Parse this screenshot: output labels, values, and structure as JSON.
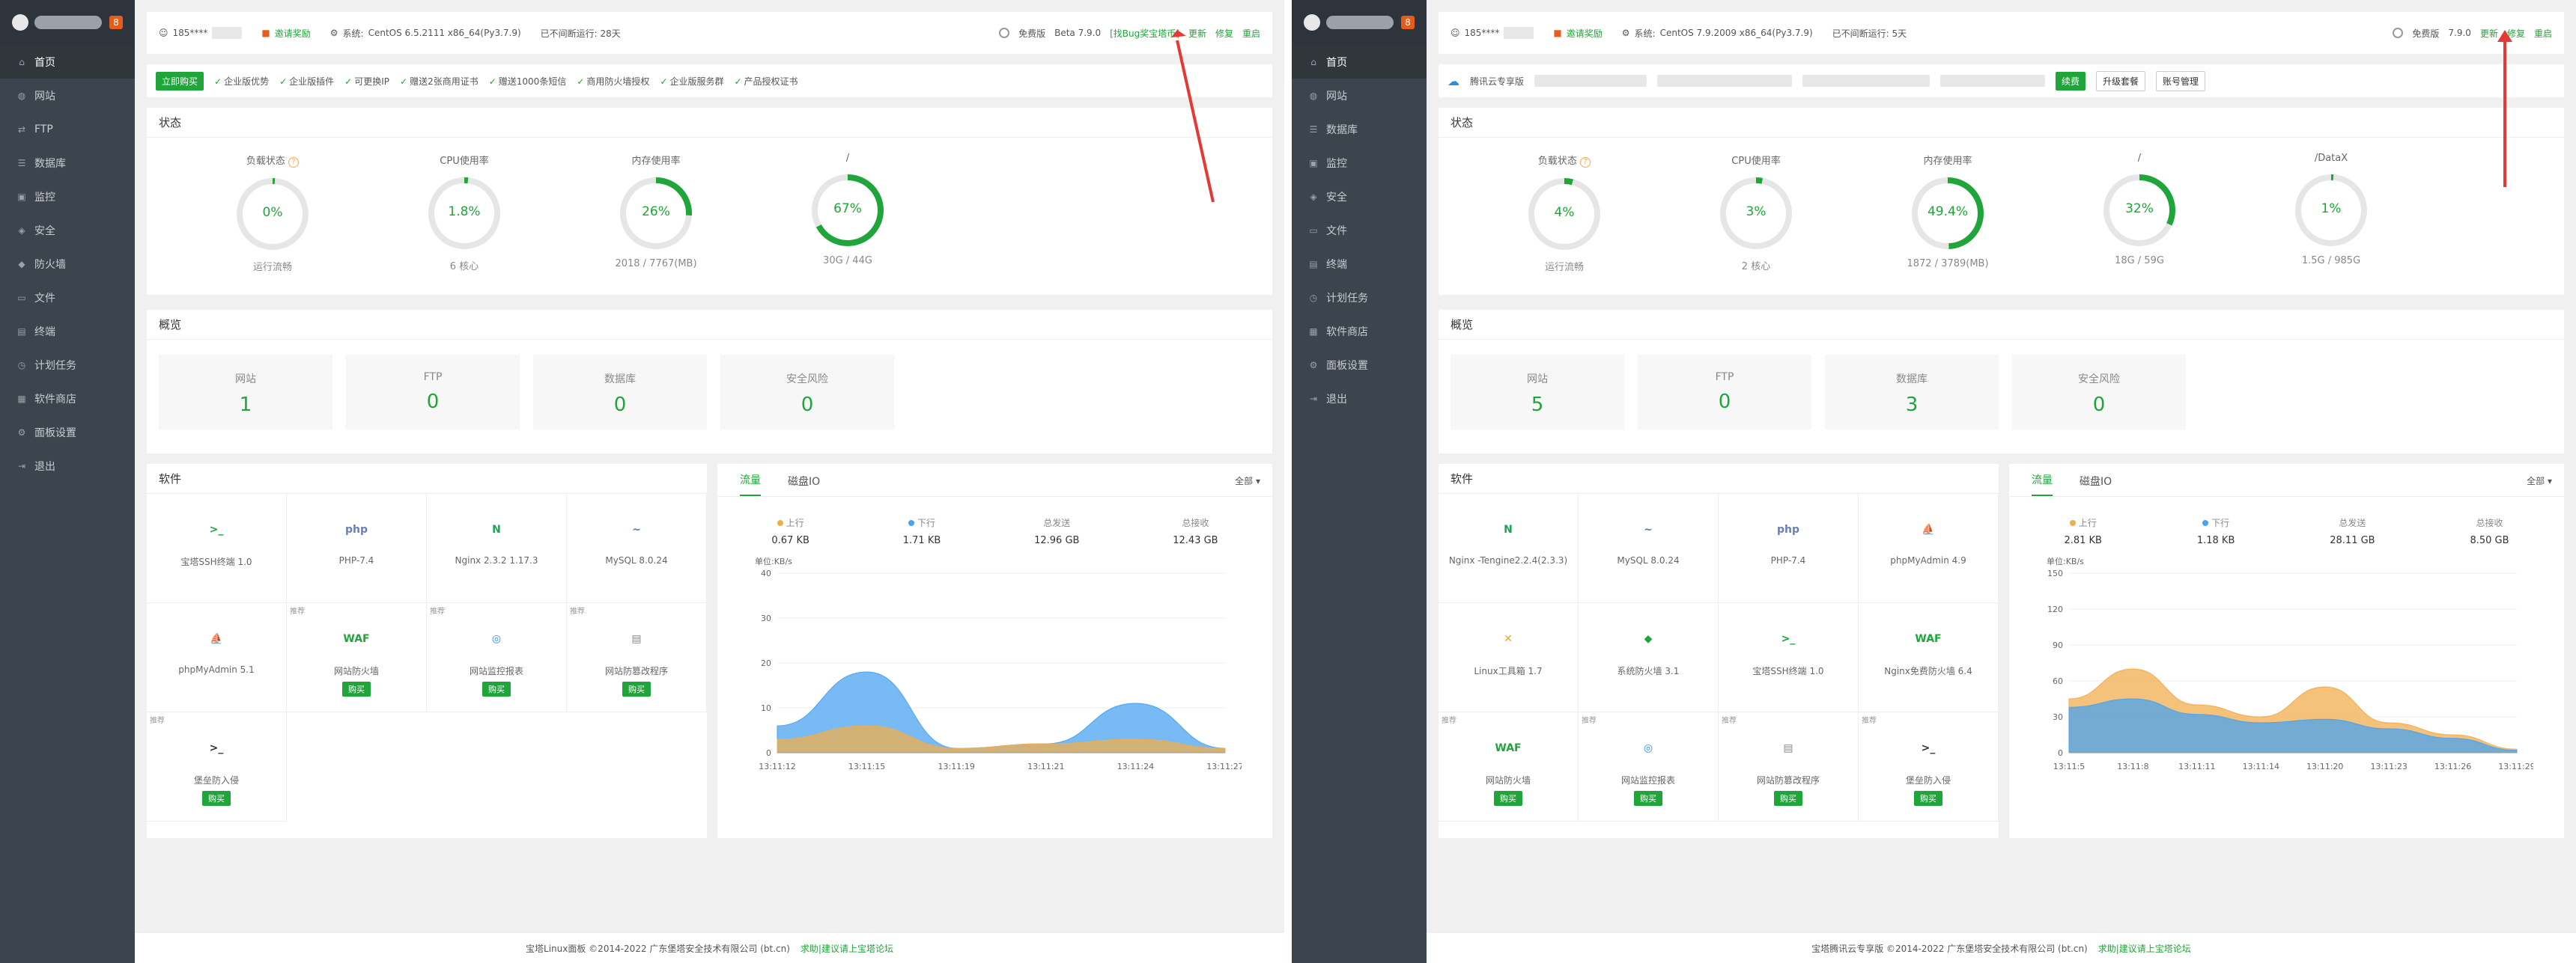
{
  "left": {
    "user_masked": "185****",
    "invite": "邀请奖励",
    "system_label": "系统:",
    "system_value": "CentOS 6.5.2111 x86_64(Py3.7.9)",
    "uptime": "已不间断运行: 28天",
    "edition": "免费版",
    "version": "Beta 7.9.0",
    "bug_link": "[找Bug奖宝塔币]",
    "update": "更新",
    "repair": "修复",
    "restart": "重启",
    "promo_button": "立即购买",
    "promo_items": [
      "企业版优势",
      "企业版插件",
      "可更换IP",
      "赠送2张商用证书",
      "赠送1000条短信",
      "商用防火墙授权",
      "企业版服务群",
      "产品授权证书"
    ],
    "status_title": "状态",
    "gauges": [
      {
        "title": "负载状态",
        "pct": 0,
        "text": "0%",
        "sub": "运行流畅",
        "q": "?"
      },
      {
        "title": "CPU使用率",
        "pct": 1.8,
        "text": "1.8%",
        "sub": "6 核心"
      },
      {
        "title": "内存使用率",
        "pct": 26,
        "text": "26%",
        "sub": "2018 / 7767(MB)"
      },
      {
        "title": "/",
        "pct": 67,
        "text": "67%",
        "sub": "30G / 44G"
      }
    ],
    "overview_title": "概览",
    "overview": [
      {
        "label": "网站",
        "value": "1"
      },
      {
        "label": "FTP",
        "value": "0"
      },
      {
        "label": "数据库",
        "value": "0"
      },
      {
        "label": "安全风险",
        "value": "0"
      }
    ],
    "software_title": "软件",
    "software": [
      {
        "name": "宝塔SSH终端 1.0",
        "icon": "terminal-icon",
        "glyph": ">_",
        "color": "#20a53a",
        "tag": "",
        "buy": ""
      },
      {
        "name": "PHP-7.4",
        "icon": "php-icon",
        "glyph": "php",
        "color": "#6c7eb7",
        "tag": "",
        "buy": ""
      },
      {
        "name": "Nginx 2.3.2 1.17.3",
        "icon": "nginx-icon",
        "glyph": "N",
        "color": "#1aa454",
        "tag": "",
        "buy": ""
      },
      {
        "name": "MySQL 8.0.24",
        "icon": "mysql-icon",
        "glyph": "~",
        "color": "#5a7aa6",
        "tag": "",
        "buy": ""
      },
      {
        "name": "phpMyAdmin 5.1",
        "icon": "phpmyadmin-icon",
        "glyph": "⛵",
        "color": "#e58f1c",
        "tag": "",
        "buy": ""
      },
      {
        "name": "网站防火墙",
        "icon": "waf-icon",
        "glyph": "WAF",
        "color": "#20a53a",
        "tag": "推荐",
        "buy": "购买"
      },
      {
        "name": "网站监控报表",
        "icon": "monitor-icon",
        "glyph": "◎",
        "color": "#2b8fd6",
        "tag": "推荐",
        "buy": "购买"
      },
      {
        "name": "网站防篡改程序",
        "icon": "tamper-icon",
        "glyph": "▤",
        "color": "#888888",
        "tag": "推荐",
        "buy": "购买"
      },
      {
        "name": "堡垒防入侵",
        "icon": "intrusion-icon",
        "glyph": ">_",
        "color": "#333333",
        "tag": "推荐",
        "buy": "购买"
      }
    ],
    "flow_tabs": [
      "流量",
      "磁盘IO"
    ],
    "flow_select": "全部",
    "flow_stats": [
      {
        "label": "上行",
        "value": "0.67 KB",
        "dot": "#f0ad4e"
      },
      {
        "label": "下行",
        "value": "1.71 KB",
        "dot": "#4aa3f0"
      },
      {
        "label": "总发送",
        "value": "12.96 GB",
        "dot": ""
      },
      {
        "label": "总接收",
        "value": "12.43 GB",
        "dot": ""
      }
    ],
    "chart_data": {
      "type": "area",
      "ylabel": "单位:KB/s",
      "ylim": [
        0,
        40
      ],
      "yticks": [
        0,
        10,
        20,
        30,
        40
      ],
      "categories": [
        "13:11:12",
        "13:11:15",
        "13:11:19",
        "13:11:21",
        "13:11:24",
        "13:11:27"
      ],
      "series": [
        {
          "color": "#4aa3f0",
          "values": [
            6,
            18,
            1,
            2,
            11,
            1
          ]
        },
        {
          "color": "#f0ad4e",
          "values": [
            3,
            6,
            1,
            2,
            3,
            1
          ]
        }
      ]
    },
    "footer_text": "宝塔Linux面板 ©2014-2022 广东堡塔安全技术有限公司 (bt.cn)",
    "footer_link": "求助|建议请上宝塔论坛"
  },
  "right": {
    "user_masked": "185****",
    "invite": "邀请奖励",
    "system_label": "系统:",
    "system_value": "CentOS 7.9.2009 x86_64(Py3.7.9)",
    "uptime": "已不间断运行: 5天",
    "edition": "免费版",
    "version": "7.9.0",
    "update": "更新",
    "repair": "修复",
    "restart": "重启",
    "cloud_label": "腾讯云专享版",
    "cloud_btns": [
      "续费",
      "升级套餐",
      "账号管理"
    ],
    "status_title": "状态",
    "gauges": [
      {
        "title": "负载状态",
        "pct": 4,
        "text": "4%",
        "sub": "运行流畅",
        "q": "?"
      },
      {
        "title": "CPU使用率",
        "pct": 3,
        "text": "3%",
        "sub": "2 核心"
      },
      {
        "title": "内存使用率",
        "pct": 49.4,
        "text": "49.4%",
        "sub": "1872 / 3789(MB)"
      },
      {
        "title": "/",
        "pct": 32,
        "text": "32%",
        "sub": "18G / 59G"
      },
      {
        "title": "/DataX",
        "pct": 1,
        "text": "1%",
        "sub": "1.5G / 985G"
      }
    ],
    "overview_title": "概览",
    "overview": [
      {
        "label": "网站",
        "value": "5"
      },
      {
        "label": "FTP",
        "value": "0"
      },
      {
        "label": "数据库",
        "value": "3"
      },
      {
        "label": "安全风险",
        "value": "0"
      }
    ],
    "software_title": "软件",
    "software": [
      {
        "name": "Nginx -Tengine2.2.4(2.3.3)",
        "icon": "nginx-icon",
        "glyph": "N",
        "color": "#1aa454",
        "tag": "",
        "buy": ""
      },
      {
        "name": "MySQL 8.0.24",
        "icon": "mysql-icon",
        "glyph": "~",
        "color": "#5a7aa6",
        "tag": "",
        "buy": ""
      },
      {
        "name": "PHP-7.4",
        "icon": "php-icon",
        "glyph": "php",
        "color": "#6c7eb7",
        "tag": "",
        "buy": ""
      },
      {
        "name": "phpMyAdmin 4.9",
        "icon": "phpmyadmin-icon",
        "glyph": "⛵",
        "color": "#e58f1c",
        "tag": "",
        "buy": ""
      },
      {
        "name": "Linux工具箱 1.7",
        "icon": "toolbox-icon",
        "glyph": "✕",
        "color": "#e5a81c",
        "tag": "",
        "buy": ""
      },
      {
        "name": "系统防火墙 3.1",
        "icon": "shield-icon",
        "glyph": "◆",
        "color": "#20a53a",
        "tag": "",
        "buy": ""
      },
      {
        "name": "宝塔SSH终端 1.0",
        "icon": "terminal-icon",
        "glyph": ">_",
        "color": "#20a53a",
        "tag": "",
        "buy": ""
      },
      {
        "name": "Nginx免费防火墙 6.4",
        "icon": "waf-icon",
        "glyph": "WAF",
        "color": "#20a53a",
        "tag": "",
        "buy": ""
      },
      {
        "name": "网站防火墙",
        "icon": "waf-icon",
        "glyph": "WAF",
        "color": "#20a53a",
        "tag": "推荐",
        "buy": "购买"
      },
      {
        "name": "网站监控报表",
        "icon": "monitor-icon",
        "glyph": "◎",
        "color": "#2b8fd6",
        "tag": "推荐",
        "buy": "购买"
      },
      {
        "name": "网站防篡改程序",
        "icon": "tamper-icon",
        "glyph": "▤",
        "color": "#888888",
        "tag": "推荐",
        "buy": "购买"
      },
      {
        "name": "堡垒防入侵",
        "icon": "intrusion-icon",
        "glyph": ">_",
        "color": "#333333",
        "tag": "推荐",
        "buy": "购买"
      }
    ],
    "flow_tabs": [
      "流量",
      "磁盘IO"
    ],
    "flow_select": "全部",
    "flow_stats": [
      {
        "label": "上行",
        "value": "2.81 KB",
        "dot": "#f0ad4e"
      },
      {
        "label": "下行",
        "value": "1.18 KB",
        "dot": "#4aa3f0"
      },
      {
        "label": "总发送",
        "value": "28.11 GB",
        "dot": ""
      },
      {
        "label": "总接收",
        "value": "8.50 GB",
        "dot": ""
      }
    ],
    "chart_data": {
      "type": "area",
      "ylabel": "单位:KB/s",
      "ylim": [
        0,
        150
      ],
      "yticks": [
        0,
        30,
        60,
        90,
        120,
        150
      ],
      "categories": [
        "13:11:5",
        "13:11:8",
        "13:11:11",
        "13:11:14",
        "13:11:20",
        "13:11:23",
        "13:11:26",
        "13:11:29"
      ],
      "series": [
        {
          "color": "#f0ad4e",
          "values": [
            45,
            70,
            40,
            30,
            55,
            25,
            15,
            3
          ]
        },
        {
          "color": "#4aa3f0",
          "values": [
            38,
            45,
            32,
            25,
            28,
            20,
            12,
            2
          ]
        }
      ]
    },
    "footer_text": "宝塔腾讯云专享版 ©2014-2022 广东堡塔安全技术有限公司 (bt.cn)",
    "footer_link": "求助|建议请上宝塔论坛"
  },
  "sidebar": {
    "items_left": [
      {
        "label": "首页",
        "icon": "home-icon",
        "g": "⌂"
      },
      {
        "label": "网站",
        "icon": "globe-icon",
        "g": "◍"
      },
      {
        "label": "FTP",
        "icon": "ftp-icon",
        "g": "⇄"
      },
      {
        "label": "数据库",
        "icon": "database-icon",
        "g": "☰"
      },
      {
        "label": "监控",
        "icon": "monitor-icon",
        "g": "▣"
      },
      {
        "label": "安全",
        "icon": "shield-icon",
        "g": "◈"
      },
      {
        "label": "防火墙",
        "icon": "firewall-icon",
        "g": "◆"
      },
      {
        "label": "文件",
        "icon": "folder-icon",
        "g": "▭"
      },
      {
        "label": "终端",
        "icon": "terminal-icon",
        "g": "▤"
      },
      {
        "label": "计划任务",
        "icon": "clock-icon",
        "g": "◷"
      },
      {
        "label": "软件商店",
        "icon": "store-icon",
        "g": "▦"
      },
      {
        "label": "面板设置",
        "icon": "gear-icon",
        "g": "⚙"
      },
      {
        "label": "退出",
        "icon": "logout-icon",
        "g": "⇥"
      }
    ],
    "items_right": [
      {
        "label": "首页",
        "icon": "home-icon",
        "g": "⌂"
      },
      {
        "label": "网站",
        "icon": "globe-icon",
        "g": "◍"
      },
      {
        "label": "数据库",
        "icon": "database-icon",
        "g": "☰"
      },
      {
        "label": "监控",
        "icon": "monitor-icon",
        "g": "▣"
      },
      {
        "label": "安全",
        "icon": "shield-icon",
        "g": "◈"
      },
      {
        "label": "文件",
        "icon": "folder-icon",
        "g": "▭"
      },
      {
        "label": "终端",
        "icon": "terminal-icon",
        "g": "▤"
      },
      {
        "label": "计划任务",
        "icon": "clock-icon",
        "g": "◷"
      },
      {
        "label": "软件商店",
        "icon": "store-icon",
        "g": "▦"
      },
      {
        "label": "面板设置",
        "icon": "gear-icon",
        "g": "⚙"
      },
      {
        "label": "退出",
        "icon": "logout-icon",
        "g": "⇥"
      }
    ]
  }
}
